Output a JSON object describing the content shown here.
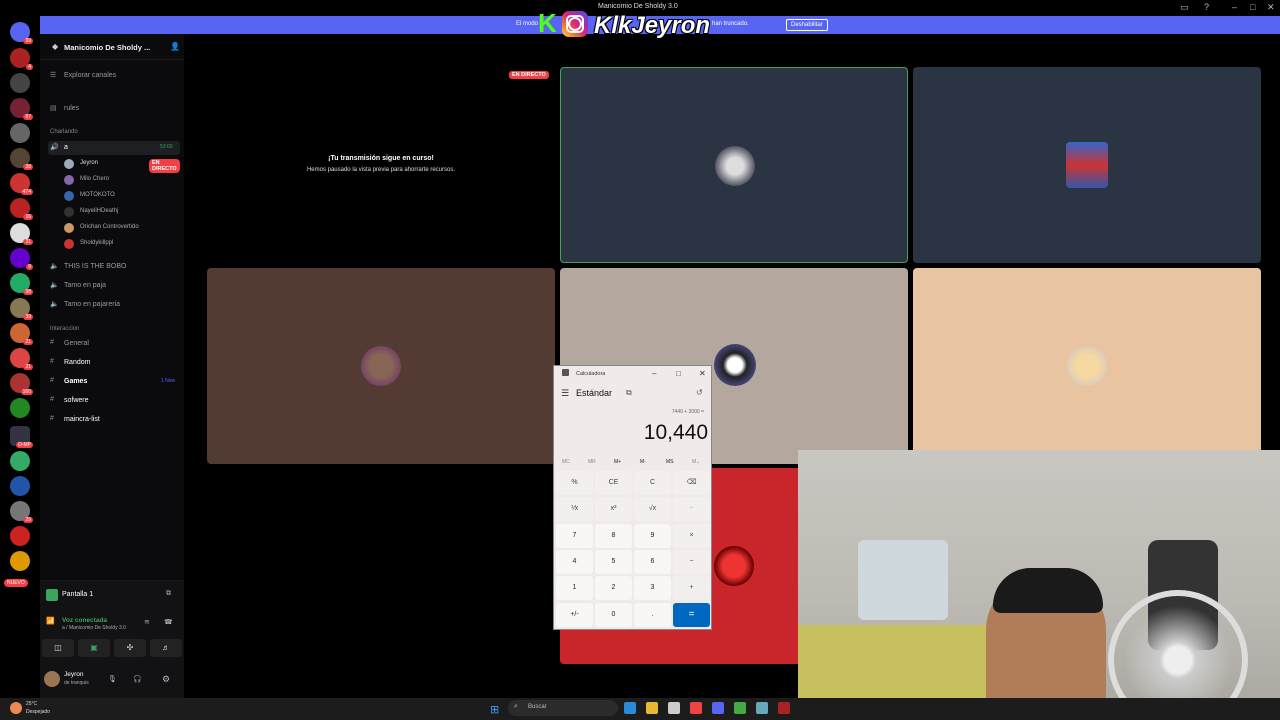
{
  "window": {
    "title": "Manicomio De Sholdy 3.0"
  },
  "banner": {
    "message_start": "El modo",
    "message_end": "han truncado.",
    "action": "Deshabilitar"
  },
  "overlay": {
    "k": "K",
    "handle": "KlkJeyron"
  },
  "server_rail": {
    "nuevo_label": "NUEVO",
    "badges": [
      "99",
      "4",
      "87",
      "38",
      "474",
      "16",
      "31",
      "9",
      "98",
      "39",
      "21",
      "21",
      "160",
      "D-MP",
      "29"
    ]
  },
  "sidebar": {
    "server_name": "Manicomio De Sholdy ...",
    "explore": "Explorar canales",
    "rules": "rules",
    "cat_chat": "Charlando",
    "voice_channel_a": "a",
    "voice_timer": "53:03",
    "voice_users": [
      "Jeyron",
      "Milo Chero",
      "MOTOKOTO",
      "NayeliHDeathj",
      "Orichan Controvertido",
      "Sholdykillppl"
    ],
    "live_label": "EN DIRECTO",
    "voice2": "THIS IS THE BOBO",
    "voice3": "Tamo en paja",
    "voice4": "Tamo en pajareria",
    "cat_interaction": "Interaccion",
    "text_channels": [
      {
        "name": "General",
        "extra": ""
      },
      {
        "name": "Random",
        "extra": ""
      },
      {
        "name": "Games",
        "extra": "1 New"
      },
      {
        "name": "sofwere",
        "extra": ""
      },
      {
        "name": "maincra-list",
        "extra": ""
      }
    ]
  },
  "voice_panel": {
    "screen_label": "Pantalla 1",
    "connected": "Voz conectada",
    "connected_sub": "a / Manicomio De Sholdy 3.0",
    "user": "Jeyron",
    "user_status": "de tranquis"
  },
  "stream": {
    "message_title": "¡Tu transmisión sigue en curso!",
    "message_body": "Hemos pausado la vista previa para ahorrarte recursos.",
    "live_badge": "EN DIRECTO"
  },
  "calculator": {
    "window_title": "Calculadora",
    "mode": "Estándar",
    "expression": "7440 + 3000 =",
    "display": "10,440",
    "memory": [
      "MC",
      "MR",
      "M+",
      "M-",
      "MS",
      "M⌄"
    ],
    "keys": [
      [
        "%",
        "CE",
        "C",
        "⌫"
      ],
      [
        "⅟x",
        "x²",
        "√x",
        "÷"
      ],
      [
        "7",
        "8",
        "9",
        "×"
      ],
      [
        "4",
        "5",
        "6",
        "−"
      ],
      [
        "1",
        "2",
        "3",
        "+"
      ],
      [
        "+/-",
        "0",
        ".",
        "="
      ]
    ]
  },
  "taskbar": {
    "temp": "25°C",
    "weather": "Despejado",
    "search": "Buscar"
  },
  "colors": {
    "banner": "#5865f2",
    "live": "#f23f43",
    "speaking_border": "#3ba55d",
    "calc_equals": "#0067c0"
  }
}
